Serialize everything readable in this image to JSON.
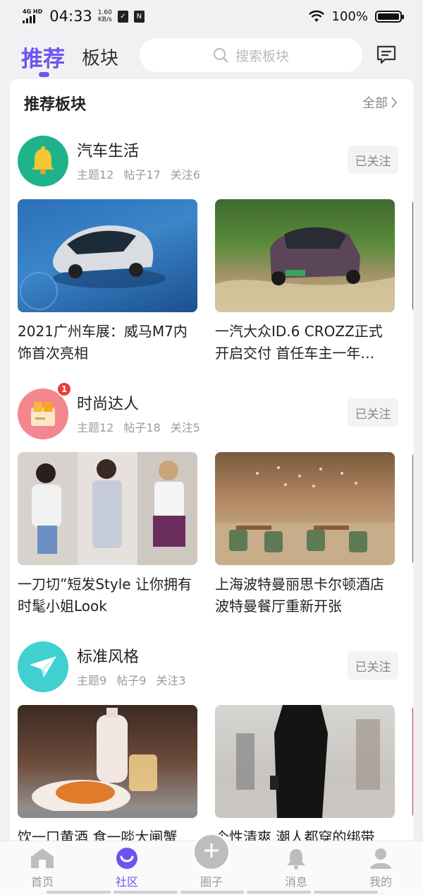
{
  "status_bar": {
    "network": "4G HD",
    "time": "04:33",
    "speed_value": "1.60",
    "speed_unit": "KB/s",
    "battery": "100%"
  },
  "header": {
    "tab_active": "推荐",
    "tab_other": "板块",
    "search_placeholder": "搜索板块"
  },
  "section": {
    "title": "推荐板块",
    "all_label": "全部"
  },
  "forums": [
    {
      "name": "汽车生活",
      "stats": [
        "主题12",
        "帖子17",
        "关注6"
      ],
      "follow_label": "已关注",
      "badge": "",
      "posts": [
        {
          "title": "2021广州车展：威马M7内饰首次亮相"
        },
        {
          "title": "一汽大众ID.6 CROZZ正式开启交付 首任车主一年…"
        }
      ]
    },
    {
      "name": "时尚达人",
      "stats": [
        "主题12",
        "帖子18",
        "关注5"
      ],
      "follow_label": "已关注",
      "badge": "1",
      "posts": [
        {
          "title": "一刀切”短发Style 让你拥有时髦小姐Look"
        },
        {
          "title": "上海波特曼丽思卡尔顿酒店波特曼餐厅重新开张"
        }
      ]
    },
    {
      "name": "标准风格",
      "stats": [
        "主题9",
        "帖子9",
        "关注3"
      ],
      "follow_label": "已关注",
      "badge": "",
      "posts": [
        {
          "title": "饮一口黄酒 食一啖大闸蟹"
        },
        {
          "title": "个性清爽 潮人都穿的绑带"
        }
      ]
    }
  ],
  "bottom_nav": {
    "home": "首页",
    "community": "社区",
    "circle": "圈子",
    "messages": "消息",
    "mine": "我的"
  },
  "colors": {
    "accent": "#6f53f0",
    "badge": "#f03b3b",
    "muted": "#9b9b9b"
  }
}
